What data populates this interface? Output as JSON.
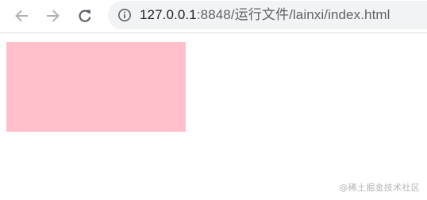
{
  "browser": {
    "url": {
      "host": "127.0.0.1",
      "rest": ":8848/运行文件/lainxi/index.html"
    },
    "icons": {
      "back": "arrow-left-icon",
      "forward": "arrow-right-icon",
      "reload": "reload-icon",
      "site_info": "info-circle-icon"
    },
    "colors": {
      "toolbar_icon": "#5f6368",
      "omnibox_bg": "#f1f3f4"
    }
  },
  "page": {
    "box_color": "#ffc0cb",
    "watermark": "@稀土掘金技术社区"
  }
}
